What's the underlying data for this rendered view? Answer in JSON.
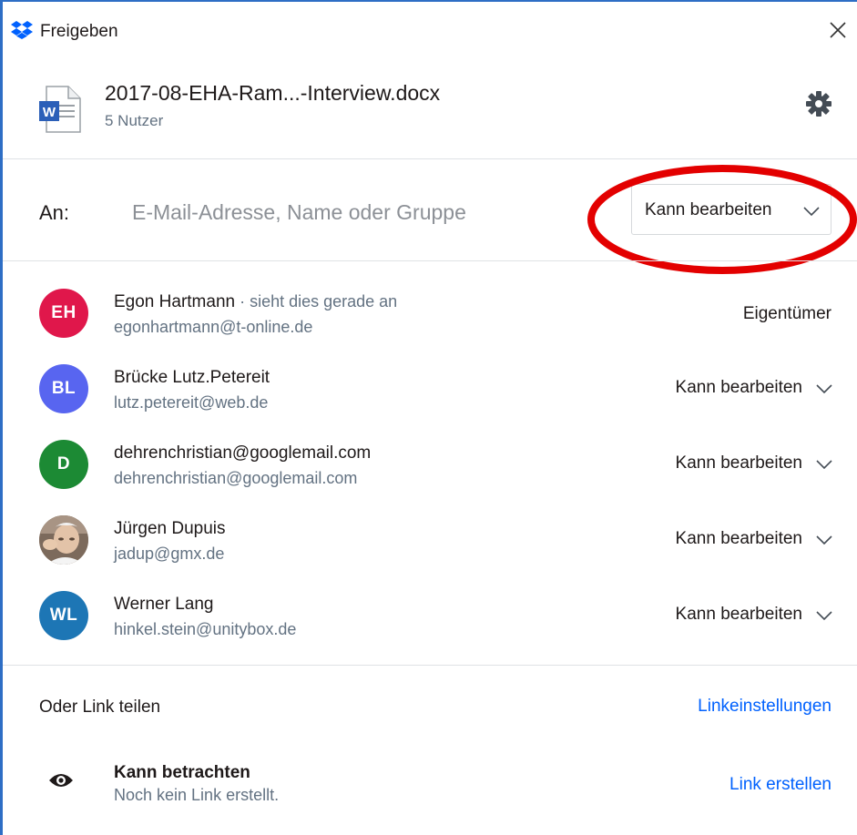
{
  "window": {
    "title": "Freigeben",
    "close_icon": "close-icon"
  },
  "file": {
    "name": "2017-08-EHA-Ram...-Interview.docx",
    "users": "5 Nutzer",
    "icon": "word-document-icon"
  },
  "share": {
    "to_label": "An:",
    "input_placeholder": "E-Mail-Adresse, Name oder Gruppe",
    "input_value": "",
    "permission": "Kann bearbeiten"
  },
  "members": [
    {
      "initials": "EH",
      "color": "#e0174b",
      "name": "Egon Hartmann",
      "status": " · sieht dies gerade an",
      "email": "egonhartmann@t-online.de",
      "role": "Eigentümer",
      "editable": false
    },
    {
      "initials": "BL",
      "color": "#5865f0",
      "name": "Brücke Lutz.Petereit",
      "status": "",
      "email": "lutz.petereit@web.de",
      "role": "Kann bearbeiten",
      "editable": true
    },
    {
      "initials": "D",
      "color": "#1c8a34",
      "name": "dehrenchristian@googlemail.com",
      "status": "",
      "email": "dehrenchristian@googlemail.com",
      "role": "Kann bearbeiten",
      "editable": true
    },
    {
      "initials": "",
      "color": "#b7a08a",
      "name": "Jürgen Dupuis",
      "status": "",
      "email": "jadup@gmx.de",
      "role": "Kann bearbeiten",
      "editable": true,
      "photo": true
    },
    {
      "initials": "WL",
      "color": "#1d76b5",
      "name": "Werner Lang",
      "status": "",
      "email": "hinkel.stein@unitybox.de",
      "role": "Kann bearbeiten",
      "editable": true
    }
  ],
  "link": {
    "heading": "Oder Link teilen",
    "settings_label": "Linkeinstellungen",
    "view_title": "Kann betrachten",
    "view_subtitle": "Noch kein Link erstellt.",
    "create_label": "Link erstellen"
  },
  "colors": {
    "accent_blue": "#0061fe",
    "annotation_red": "#e30000",
    "window_border": "#2e6ec5"
  }
}
